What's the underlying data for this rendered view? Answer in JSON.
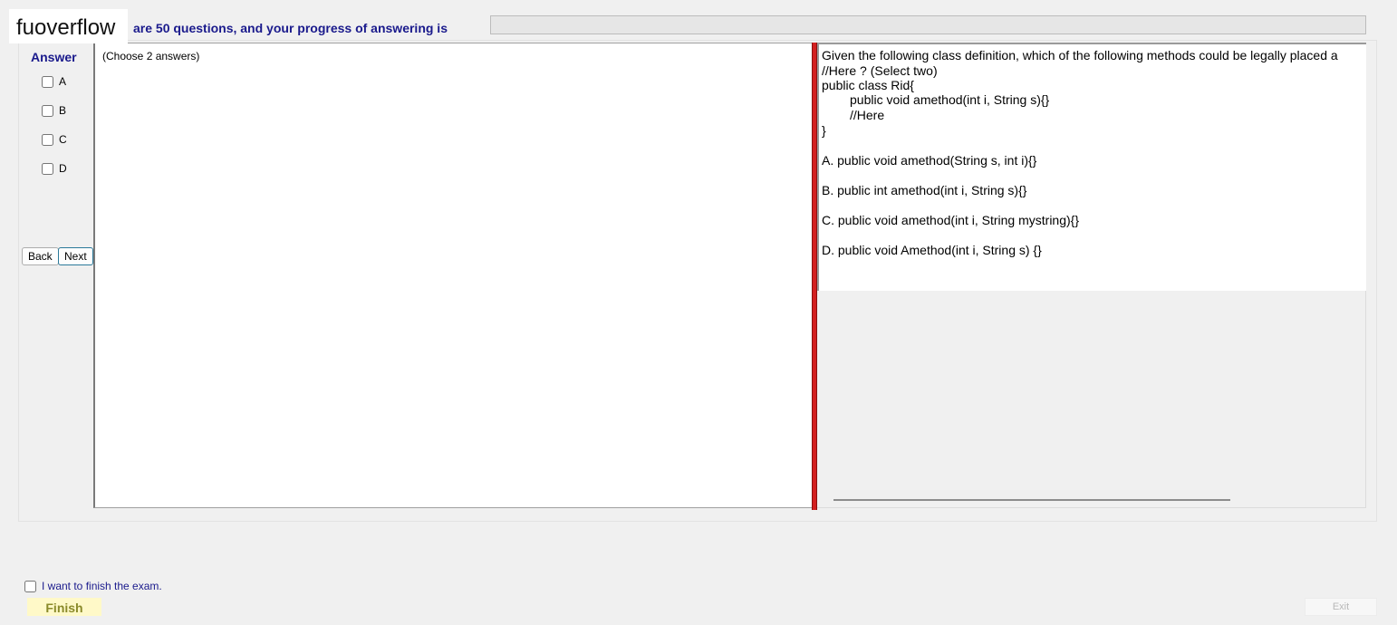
{
  "watermark": "fuoverflow",
  "header": {
    "progress_text": "are 50 questions, and your progress of answering is",
    "progress_percent": 0
  },
  "answer_panel": {
    "label": "Answer",
    "options": [
      {
        "label": "A",
        "checked": false
      },
      {
        "label": "B",
        "checked": false
      },
      {
        "label": "C",
        "checked": false
      },
      {
        "label": "D",
        "checked": false
      }
    ],
    "back_label": "Back",
    "next_label": "Next",
    "hint": "(Choose 2 answers)"
  },
  "question": {
    "line1": "Given the following class definition, which of the following methods could be legally placed a",
    "line2": "//Here ? (Select two)",
    "line3": "public class Rid{",
    "line4": "public void amethod(int i, String s){}",
    "line5": "//Here",
    "line6": "}",
    "choices": [
      "A.  public void amethod(String s, int i){}",
      "B.  public int amethod(int i, String s){}",
      "C.  public void amethod(int i, String mystring){}",
      "D.  public void Amethod(int i, String s) {}"
    ]
  },
  "footer": {
    "finish_checkbox_label": "I want to finish the exam.",
    "finish_label": "Finish",
    "exit_label": "Exit"
  },
  "colors": {
    "label_blue": "#1a1a8c",
    "splitter_red": "#d32020",
    "finish_bg": "#fff9c8"
  }
}
